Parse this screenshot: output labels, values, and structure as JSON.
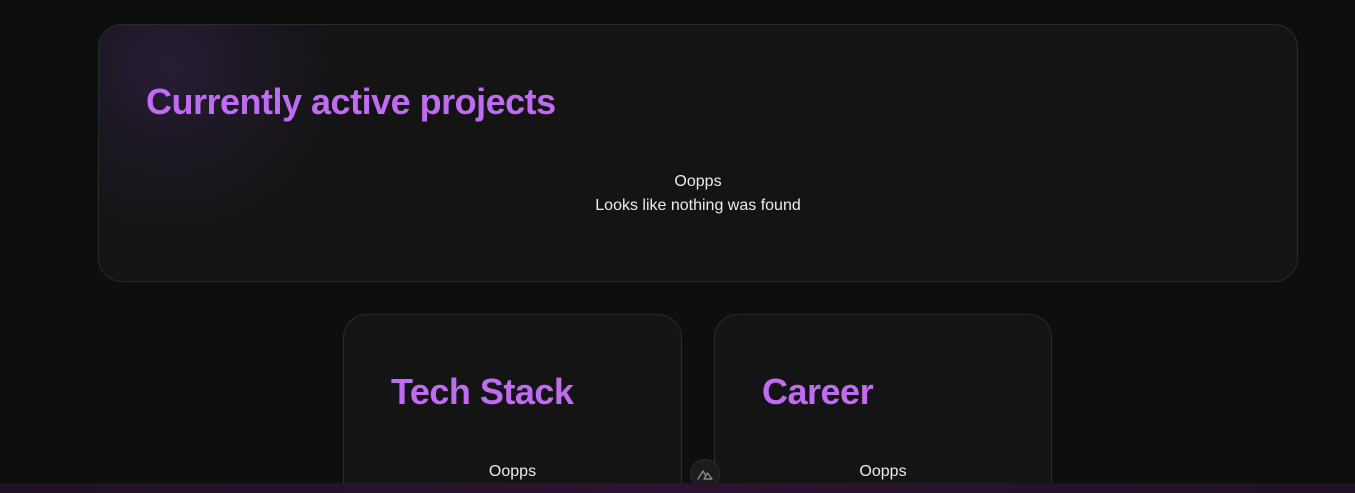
{
  "sections": {
    "active_projects": {
      "title": "Currently active projects",
      "empty_title": "Oopps",
      "empty_message": "Looks like nothing was found"
    },
    "tech_stack": {
      "title": "Tech Stack",
      "empty_title": "Oopps"
    },
    "career": {
      "title": "Career",
      "empty_title": "Oopps"
    }
  },
  "devtools": {
    "icon": "nuxt-icon"
  },
  "colors": {
    "accent": "#c06cf2",
    "background": "#0e0e0f",
    "card": "#141415",
    "border": "#2b2b2e"
  }
}
